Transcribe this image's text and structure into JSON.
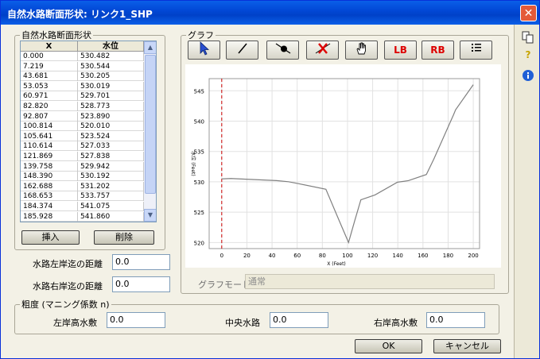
{
  "window": {
    "title": "自然水路断面形状: リンク1_SHP",
    "close_glyph": "✕"
  },
  "section_group": {
    "legend": "自然水路断面形状"
  },
  "table": {
    "headers": [
      "X",
      "水位"
    ],
    "rows": [
      [
        "0.000",
        "530.482"
      ],
      [
        "7.219",
        "530.544"
      ],
      [
        "43.681",
        "530.205"
      ],
      [
        "53.053",
        "530.019"
      ],
      [
        "60.971",
        "529.701"
      ],
      [
        "82.820",
        "528.773"
      ],
      [
        "92.807",
        "523.890"
      ],
      [
        "100.814",
        "520.010"
      ],
      [
        "105.641",
        "523.524"
      ],
      [
        "110.614",
        "527.033"
      ],
      [
        "121.869",
        "527.838"
      ],
      [
        "139.758",
        "529.942"
      ],
      [
        "148.390",
        "530.192"
      ],
      [
        "162.688",
        "531.202"
      ],
      [
        "168.653",
        "533.757"
      ],
      [
        "184.374",
        "541.075"
      ],
      [
        "185.928",
        "541.860"
      ]
    ]
  },
  "buttons": {
    "insert": "挿入",
    "delete": "削除",
    "ok": "OK",
    "cancel": "キャンセル"
  },
  "distance": {
    "left_label": "水路左岸迄の距離",
    "left_value": "0.0",
    "right_label": "水路右岸迄の距離",
    "right_value": "0.0"
  },
  "graph_group": {
    "legend": "グラフ",
    "mode_label": "グラフモード",
    "mode_value": "通常"
  },
  "toolbar": {
    "lb_label": "LB",
    "rb_label": "RB"
  },
  "roughness": {
    "legend": "粗度 (マニング係数 n)",
    "left_label": "左岸高水敷",
    "left_value": "0.0",
    "center_label": "中央水路",
    "center_value": "0.0",
    "right_label": "右岸高水敷",
    "right_value": "0.0"
  },
  "colors": {
    "accent": "#0a5fe8",
    "line": "#808080",
    "marker": "#cc0000"
  },
  "chart_data": {
    "type": "line",
    "xlabel": "X (Feet)",
    "ylabel": "水位 (Feet)",
    "xlim": [
      -10,
      205
    ],
    "ylim": [
      519,
      547
    ],
    "xticks": [
      0,
      20,
      40,
      60,
      80,
      100,
      120,
      140,
      160,
      180,
      200
    ],
    "yticks": [
      520,
      525,
      530,
      535,
      540,
      545
    ],
    "grid": true,
    "marker_x": 0,
    "series": [
      {
        "x": [
          0,
          7.219,
          43.681,
          53.053,
          60.971,
          82.82,
          92.807,
          100.814,
          105.641,
          110.614,
          121.869,
          139.758,
          148.39,
          162.688,
          168.653,
          184.374,
          185.928,
          200
        ],
        "y": [
          530.482,
          530.544,
          530.205,
          530.019,
          529.701,
          528.773,
          523.89,
          520.01,
          523.524,
          527.033,
          527.838,
          529.942,
          530.192,
          531.202,
          533.757,
          541.075,
          541.86,
          546
        ]
      }
    ]
  }
}
